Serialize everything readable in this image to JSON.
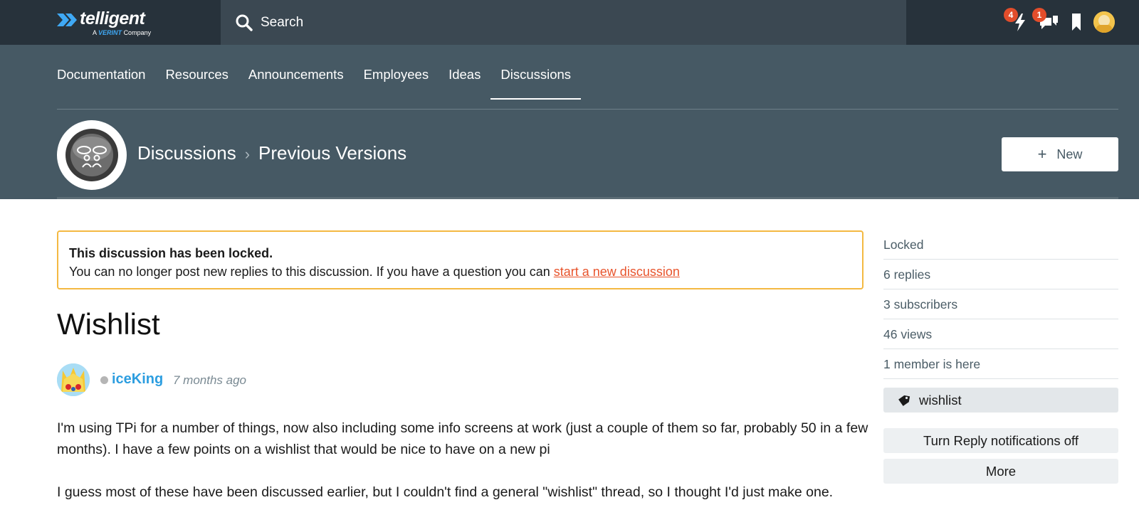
{
  "brand": {
    "logo_text": "telligent",
    "logo_sub_prefix": "A",
    "logo_sub_brand": "VERINT",
    "logo_sub_suffix": "Company"
  },
  "search": {
    "placeholder": "Search"
  },
  "topbar": {
    "notifications_badge": "4",
    "messages_badge": "1",
    "icons": [
      "notifications-icon",
      "messages-icon",
      "bookmarks-icon",
      "user-avatar"
    ]
  },
  "nav": {
    "items": [
      "Documentation",
      "Resources",
      "Announcements",
      "Employees",
      "Ideas",
      "Discussions"
    ],
    "active": "Discussions"
  },
  "breadcrumb": {
    "items": [
      "Discussions",
      "Previous Versions"
    ],
    "separator": "›"
  },
  "new_button": {
    "icon": "+",
    "label": "New"
  },
  "notice": {
    "title": "This discussion has been locked.",
    "text": "You can no longer post new replies to this discussion. If you have a question you can ",
    "link": "start a new discussion"
  },
  "post": {
    "title": "Wishlist",
    "author": "iceKing",
    "date": "7 months ago",
    "paragraphs": [
      "I'm using TPi for a number of things, now also including some info screens at work (just a couple of them so far, probably 50 in a few months). I have a few points on a wishlist that would be nice to have on a new pi",
      "I guess most of these have been discussed earlier, but I couldn't find a general \"wishlist\" thread, so I thought I'd just make one."
    ]
  },
  "sidebar": {
    "stats": [
      "Locked",
      "6 replies",
      "3 subscribers",
      "46 views",
      "1 member is here"
    ],
    "tag": "wishlist",
    "buttons": [
      "Turn Reply notifications off",
      "More"
    ]
  },
  "colors": {
    "topbar": "#27323b",
    "search": "#3b4852",
    "header": "#465964",
    "notice_border": "#f4b942",
    "link": "#e8542c",
    "author": "#2d9ee0",
    "badge": "#e24d2b"
  }
}
